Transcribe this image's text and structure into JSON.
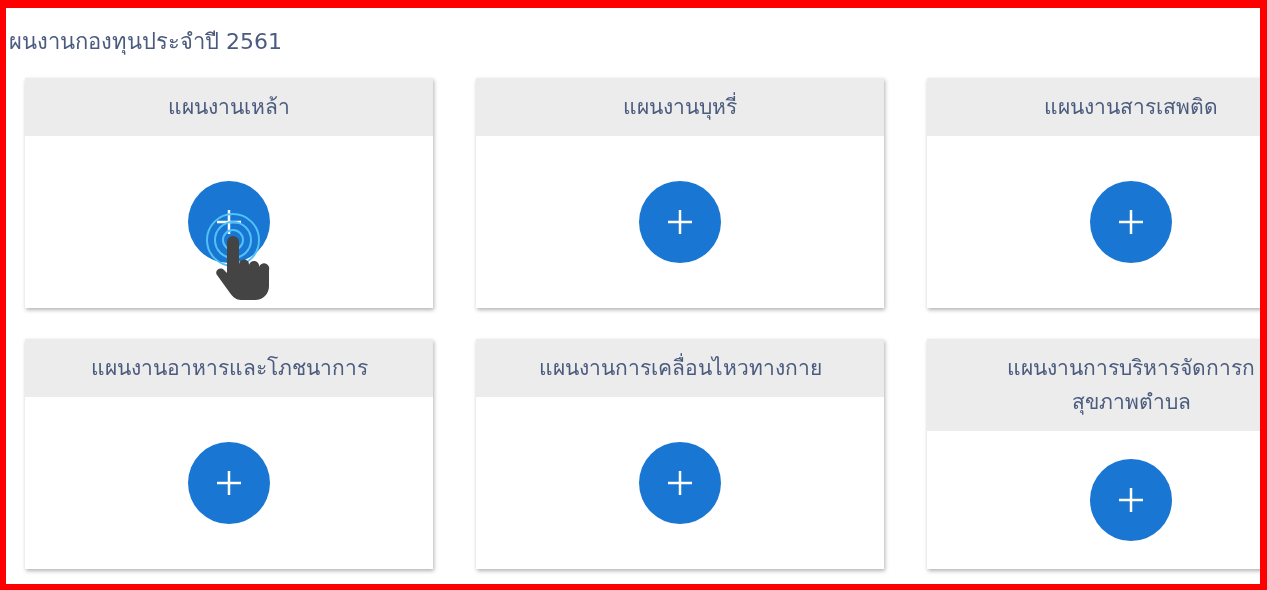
{
  "page_title": "ผนงานกองทุนประจำปี 2561",
  "cards": [
    {
      "title_lines": [
        "แผนงานเหล้า"
      ],
      "pointer_hint": true
    },
    {
      "title_lines": [
        "แผนงานบุหรี่"
      ],
      "pointer_hint": false
    },
    {
      "title_lines": [
        "แผนงานสารเสพติด"
      ],
      "pointer_hint": false
    },
    {
      "title_lines": [
        "แผนงานอาหารและโภชนาการ"
      ],
      "pointer_hint": false
    },
    {
      "title_lines": [
        "แผนงานการเคลื่อนไหวทางกาย"
      ],
      "pointer_hint": false
    },
    {
      "title_lines": [
        "แผนงานการบริหารจัดการก",
        "สุขภาพตำบล"
      ],
      "pointer_hint": false
    }
  ]
}
